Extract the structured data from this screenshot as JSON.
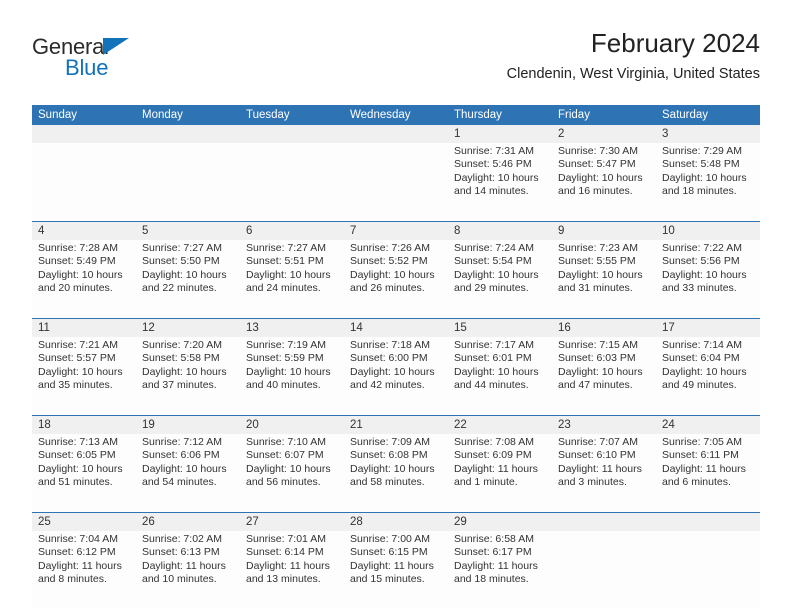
{
  "brand": {
    "name_top": "General",
    "name_bottom": "Blue",
    "triangle_color": "#1273ba",
    "text_color": "#2b2b2b"
  },
  "header": {
    "title": "February 2024",
    "subtitle": "Clendenin, West Virginia, United States"
  },
  "theme": {
    "header_blue": "#2e74b5",
    "daynum_band": "#f0f0f0",
    "cell_background": "#fdfdfd",
    "text": "#333333"
  },
  "calendar": {
    "weekday_headers": [
      "Sunday",
      "Monday",
      "Tuesday",
      "Wednesday",
      "Thursday",
      "Friday",
      "Saturday"
    ],
    "weeks": [
      [
        {
          "day": "",
          "lines": []
        },
        {
          "day": "",
          "lines": []
        },
        {
          "day": "",
          "lines": []
        },
        {
          "day": "",
          "lines": []
        },
        {
          "day": "1",
          "lines": [
            "Sunrise: 7:31 AM",
            "Sunset: 5:46 PM",
            "Daylight: 10 hours",
            "and 14 minutes."
          ]
        },
        {
          "day": "2",
          "lines": [
            "Sunrise: 7:30 AM",
            "Sunset: 5:47 PM",
            "Daylight: 10 hours",
            "and 16 minutes."
          ]
        },
        {
          "day": "3",
          "lines": [
            "Sunrise: 7:29 AM",
            "Sunset: 5:48 PM",
            "Daylight: 10 hours",
            "and 18 minutes."
          ]
        }
      ],
      [
        {
          "day": "4",
          "lines": [
            "Sunrise: 7:28 AM",
            "Sunset: 5:49 PM",
            "Daylight: 10 hours",
            "and 20 minutes."
          ]
        },
        {
          "day": "5",
          "lines": [
            "Sunrise: 7:27 AM",
            "Sunset: 5:50 PM",
            "Daylight: 10 hours",
            "and 22 minutes."
          ]
        },
        {
          "day": "6",
          "lines": [
            "Sunrise: 7:27 AM",
            "Sunset: 5:51 PM",
            "Daylight: 10 hours",
            "and 24 minutes."
          ]
        },
        {
          "day": "7",
          "lines": [
            "Sunrise: 7:26 AM",
            "Sunset: 5:52 PM",
            "Daylight: 10 hours",
            "and 26 minutes."
          ]
        },
        {
          "day": "8",
          "lines": [
            "Sunrise: 7:24 AM",
            "Sunset: 5:54 PM",
            "Daylight: 10 hours",
            "and 29 minutes."
          ]
        },
        {
          "day": "9",
          "lines": [
            "Sunrise: 7:23 AM",
            "Sunset: 5:55 PM",
            "Daylight: 10 hours",
            "and 31 minutes."
          ]
        },
        {
          "day": "10",
          "lines": [
            "Sunrise: 7:22 AM",
            "Sunset: 5:56 PM",
            "Daylight: 10 hours",
            "and 33 minutes."
          ]
        }
      ],
      [
        {
          "day": "11",
          "lines": [
            "Sunrise: 7:21 AM",
            "Sunset: 5:57 PM",
            "Daylight: 10 hours",
            "and 35 minutes."
          ]
        },
        {
          "day": "12",
          "lines": [
            "Sunrise: 7:20 AM",
            "Sunset: 5:58 PM",
            "Daylight: 10 hours",
            "and 37 minutes."
          ]
        },
        {
          "day": "13",
          "lines": [
            "Sunrise: 7:19 AM",
            "Sunset: 5:59 PM",
            "Daylight: 10 hours",
            "and 40 minutes."
          ]
        },
        {
          "day": "14",
          "lines": [
            "Sunrise: 7:18 AM",
            "Sunset: 6:00 PM",
            "Daylight: 10 hours",
            "and 42 minutes."
          ]
        },
        {
          "day": "15",
          "lines": [
            "Sunrise: 7:17 AM",
            "Sunset: 6:01 PM",
            "Daylight: 10 hours",
            "and 44 minutes."
          ]
        },
        {
          "day": "16",
          "lines": [
            "Sunrise: 7:15 AM",
            "Sunset: 6:03 PM",
            "Daylight: 10 hours",
            "and 47 minutes."
          ]
        },
        {
          "day": "17",
          "lines": [
            "Sunrise: 7:14 AM",
            "Sunset: 6:04 PM",
            "Daylight: 10 hours",
            "and 49 minutes."
          ]
        }
      ],
      [
        {
          "day": "18",
          "lines": [
            "Sunrise: 7:13 AM",
            "Sunset: 6:05 PM",
            "Daylight: 10 hours",
            "and 51 minutes."
          ]
        },
        {
          "day": "19",
          "lines": [
            "Sunrise: 7:12 AM",
            "Sunset: 6:06 PM",
            "Daylight: 10 hours",
            "and 54 minutes."
          ]
        },
        {
          "day": "20",
          "lines": [
            "Sunrise: 7:10 AM",
            "Sunset: 6:07 PM",
            "Daylight: 10 hours",
            "and 56 minutes."
          ]
        },
        {
          "day": "21",
          "lines": [
            "Sunrise: 7:09 AM",
            "Sunset: 6:08 PM",
            "Daylight: 10 hours",
            "and 58 minutes."
          ]
        },
        {
          "day": "22",
          "lines": [
            "Sunrise: 7:08 AM",
            "Sunset: 6:09 PM",
            "Daylight: 11 hours",
            "and 1 minute."
          ]
        },
        {
          "day": "23",
          "lines": [
            "Sunrise: 7:07 AM",
            "Sunset: 6:10 PM",
            "Daylight: 11 hours",
            "and 3 minutes."
          ]
        },
        {
          "day": "24",
          "lines": [
            "Sunrise: 7:05 AM",
            "Sunset: 6:11 PM",
            "Daylight: 11 hours",
            "and 6 minutes."
          ]
        }
      ],
      [
        {
          "day": "25",
          "lines": [
            "Sunrise: 7:04 AM",
            "Sunset: 6:12 PM",
            "Daylight: 11 hours",
            "and 8 minutes."
          ]
        },
        {
          "day": "26",
          "lines": [
            "Sunrise: 7:02 AM",
            "Sunset: 6:13 PM",
            "Daylight: 11 hours",
            "and 10 minutes."
          ]
        },
        {
          "day": "27",
          "lines": [
            "Sunrise: 7:01 AM",
            "Sunset: 6:14 PM",
            "Daylight: 11 hours",
            "and 13 minutes."
          ]
        },
        {
          "day": "28",
          "lines": [
            "Sunrise: 7:00 AM",
            "Sunset: 6:15 PM",
            "Daylight: 11 hours",
            "and 15 minutes."
          ]
        },
        {
          "day": "29",
          "lines": [
            "Sunrise: 6:58 AM",
            "Sunset: 6:17 PM",
            "Daylight: 11 hours",
            "and 18 minutes."
          ]
        },
        {
          "day": "",
          "lines": []
        },
        {
          "day": "",
          "lines": []
        }
      ]
    ]
  }
}
